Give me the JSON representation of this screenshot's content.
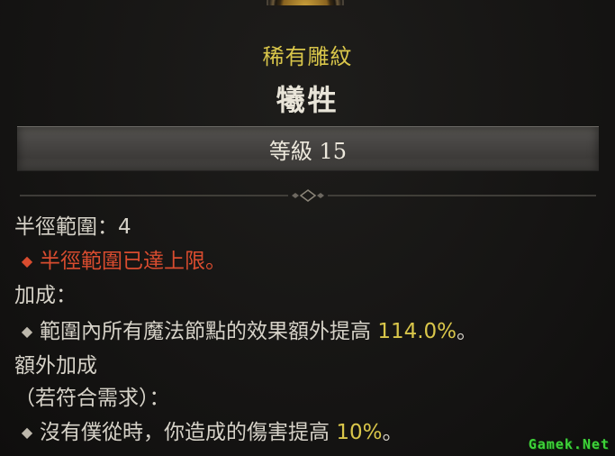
{
  "rarity": "稀有雕紋",
  "glyph_name": "犧牲",
  "level_text": "等級 15",
  "radius": {
    "label": "半徑範圍：4",
    "max_note": "半徑範圍已達上限。"
  },
  "bonus": {
    "header": "加成：",
    "text": "範圍內所有魔法節點的效果額外提高 ",
    "value": "114.0%",
    "suffix": "。"
  },
  "additional": {
    "header": "額外加成",
    "requirement": "（若符合需求）：",
    "text": "沒有僕從時，你造成的傷害提高 ",
    "value": "10%",
    "suffix": "。"
  },
  "watermark": "Gamek.Net",
  "colors": {
    "rarity": "#d9c64a",
    "warning": "#d94c2f",
    "value": "#d9c64a"
  }
}
